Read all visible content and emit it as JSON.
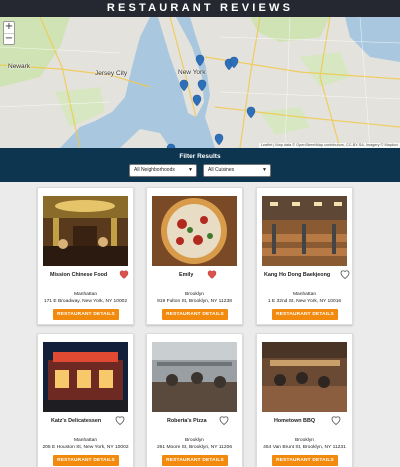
{
  "header": {
    "title": "RESTAURANT REVIEWS"
  },
  "map": {
    "zoom_in": "+",
    "zoom_out": "−",
    "labels": [
      "Newark",
      "Jersey City",
      "New York"
    ],
    "attribution": "Leaflet | Map data © OpenStreetMap contributors, CC-BY-SA, Imagery © Mapbox"
  },
  "filter": {
    "title": "Filter Results",
    "neighborhood": "All Neighborhoods",
    "cuisine": "All Cuisines"
  },
  "button_label": "RESTAURANT DETAILS",
  "colors": {
    "header": "#252831",
    "filter_bar": "#0e3550",
    "accent": "#f18a0d",
    "heart": "#d9534f"
  },
  "restaurants": [
    {
      "name": "Mission Chinese Food",
      "neighborhood": "Manhattan",
      "address": "171 E Broadway, New York, NY 10002",
      "favorite": true
    },
    {
      "name": "Emily",
      "neighborhood": "Brooklyn",
      "address": "919 Fulton St, Brooklyn, NY 11238",
      "favorite": true
    },
    {
      "name": "Kang Ho Dong Baekjeong",
      "neighborhood": "Manhattan",
      "address": "1 E 32nd St, New York, NY 10016",
      "favorite": false
    },
    {
      "name": "Katz's Delicatessen",
      "neighborhood": "Manhattan",
      "address": "205 E Houston St, New York, NY 10002",
      "favorite": false
    },
    {
      "name": "Roberta's Pizza",
      "neighborhood": "Brooklyn",
      "address": "261 Moore St, Brooklyn, NY 11206",
      "favorite": false
    },
    {
      "name": "Hometown BBQ",
      "neighborhood": "Brooklyn",
      "address": "454 Van Brunt St, Brooklyn, NY 11231",
      "favorite": false
    }
  ]
}
